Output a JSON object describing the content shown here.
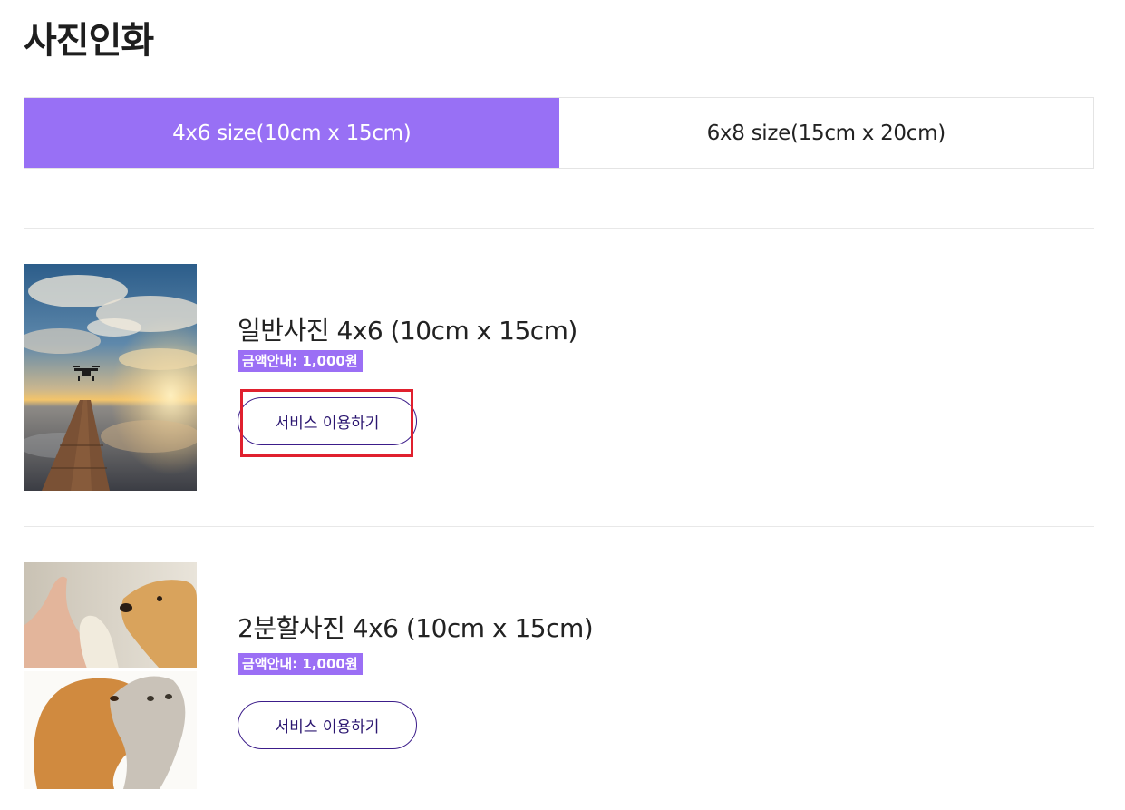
{
  "page": {
    "title": "사진인화"
  },
  "tabs": [
    {
      "label": "4x6 size(10cm x 15cm)",
      "active": true
    },
    {
      "label": "6x8 size(15cm x 20cm)",
      "active": false
    }
  ],
  "products": [
    {
      "name": "일반사진 4x6 (10cm x 15cm)",
      "price": "금액안내: 1,000원",
      "button": "서비스 이용하기",
      "image": "drone-over-pier-sunset-photo"
    },
    {
      "name": "2분할사진 4x6 (10cm x 15cm)",
      "price": "금액안내: 1,000원",
      "button": "서비스 이용하기",
      "image": "dog-and-kitten-split-photo"
    }
  ],
  "colors": {
    "accent": "#9870f5",
    "badge": "#9b6ff5",
    "button_border": "#3c1d8a",
    "highlight": "#e0202e"
  }
}
